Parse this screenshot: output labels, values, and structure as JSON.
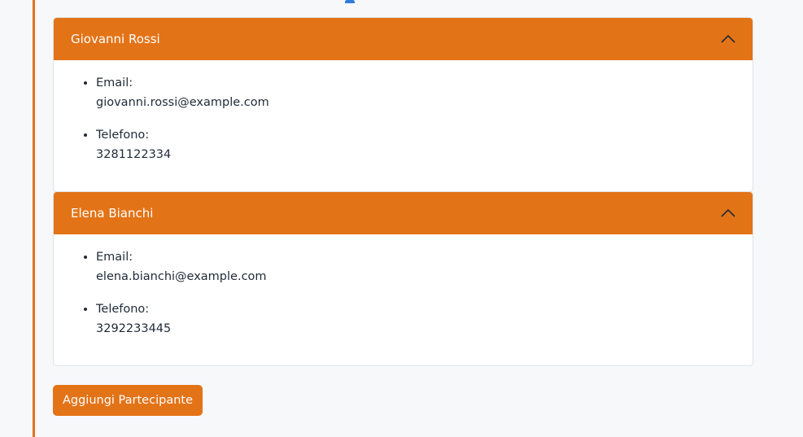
{
  "participants": [
    {
      "name": "Giovanni Rossi",
      "email_label": "Email:",
      "email": "giovanni.rossi@example.com",
      "phone_label": "Telefono:",
      "phone": "3281122334"
    },
    {
      "name": "Elena Bianchi",
      "email_label": "Email:",
      "email": "elena.bianchi@example.com",
      "phone_label": "Telefono:",
      "phone": "3292233445"
    }
  ],
  "add_button_label": "Aggiungi Partecipante",
  "colors": {
    "accent": "#e37317",
    "icon_blue": "#2f7be0"
  },
  "icons": {
    "collapse": "chevron-up-icon",
    "user": "user-icon"
  }
}
